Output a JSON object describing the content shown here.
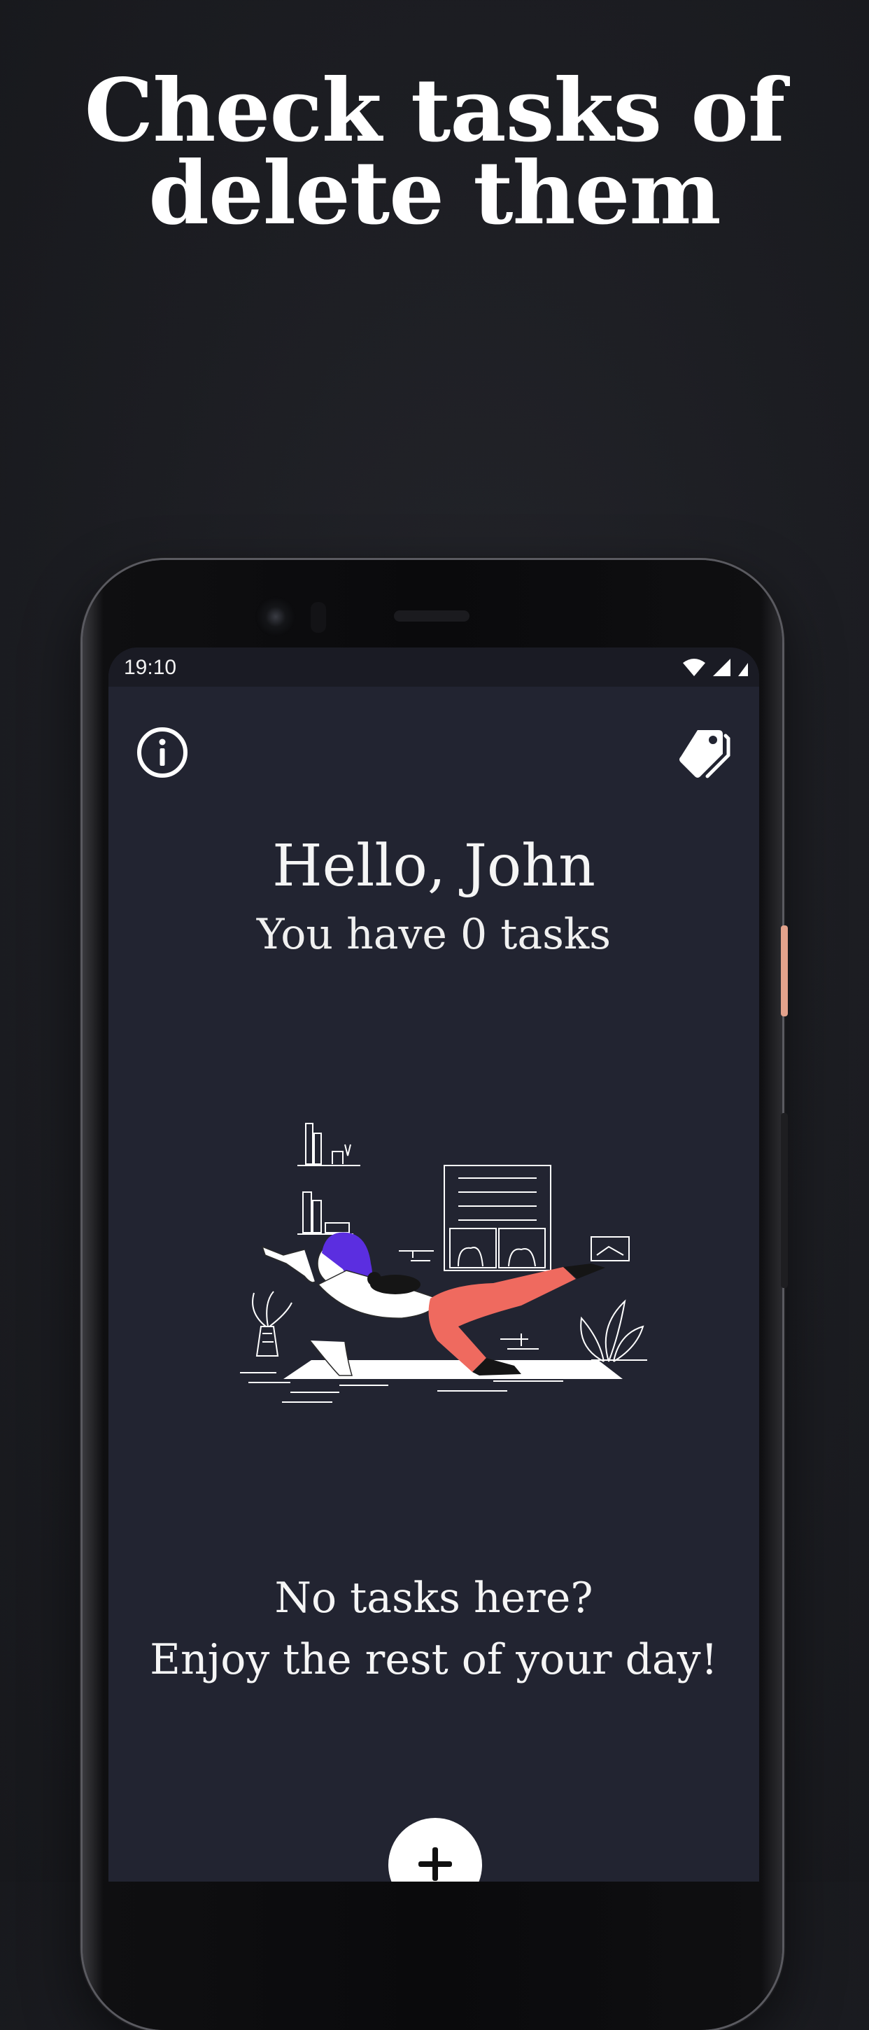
{
  "promo": {
    "headline_line1": "Check tasks of",
    "headline_line2": "delete them"
  },
  "status_bar": {
    "time": "19:10",
    "icons": [
      "wifi-icon",
      "cellular-signal-icon",
      "battery-icon"
    ]
  },
  "app_bar": {
    "left_icon": "info-icon",
    "right_icon": "tags-icon"
  },
  "header": {
    "greeting": "Hello, John",
    "task_count": "You have 0 tasks"
  },
  "empty_state": {
    "illustration": "yoga-woman-with-cat-illustration",
    "line1": "No tasks here?",
    "line2": "Enjoy the rest of your day!"
  },
  "fab": {
    "icon": "plus-icon"
  },
  "colors": {
    "page_background": "#1c1d22",
    "screen_background": "#222431",
    "text": "#ffffff",
    "illustration_accent_hair": "#5b2ee0",
    "illustration_accent_pants": "#ef6a5f",
    "phone_side_accent": "#e3a28c"
  }
}
